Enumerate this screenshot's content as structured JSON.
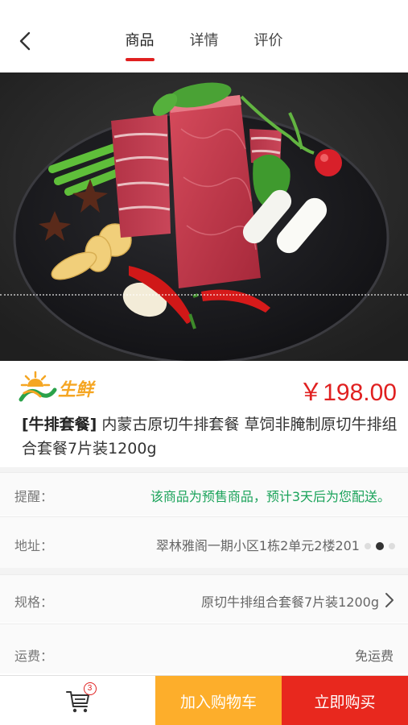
{
  "header": {
    "tabs": [
      {
        "label": "商品",
        "active": true
      },
      {
        "label": "详情",
        "active": false
      },
      {
        "label": "评价",
        "active": false
      }
    ]
  },
  "brand": {
    "logo_text": "生鲜",
    "colors": {
      "green": "#2aa24a",
      "orange": "#f5a623"
    }
  },
  "product": {
    "price": "￥198.00",
    "tag": "[牛排套餐]",
    "title": " 内蒙古原切牛排套餐 草饲非腌制原切牛排组合套餐7片装1200g"
  },
  "info": {
    "reminder": {
      "label": "提醒：",
      "value": "该商品为预售商品，预计3天后为您配送。"
    },
    "address": {
      "label": "地址：",
      "value": "翠林雅阁一期小区1栋2单元2楼201"
    },
    "spec": {
      "label": "规格：",
      "value": "原切牛排组合套餐7片装1200g"
    },
    "shipping": {
      "label": "运费：",
      "value": "免运费"
    }
  },
  "bottom": {
    "cart_count": "3",
    "add_to_cart": "加入购物车",
    "buy_now": "立即购买"
  },
  "colors": {
    "accent_red": "#e02020",
    "cart_button": "#fdae2b",
    "buy_button": "#e8281e",
    "reminder_text": "#1aa35a"
  }
}
